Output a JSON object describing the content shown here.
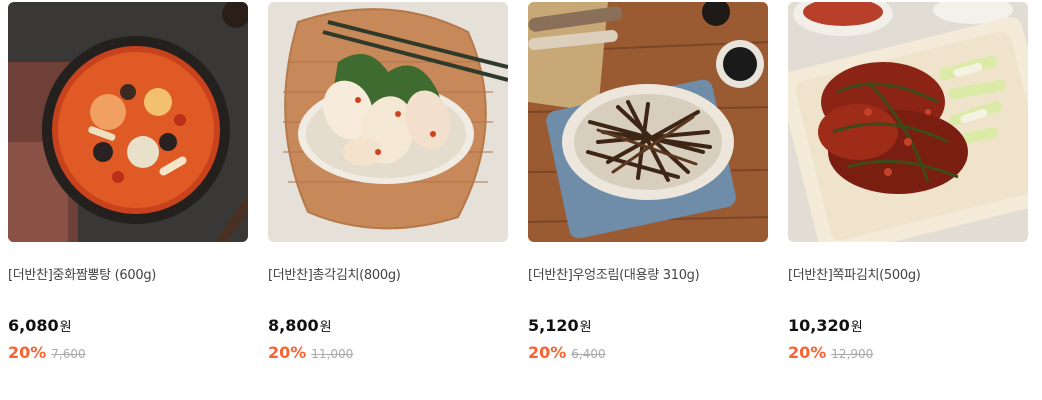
{
  "products": [
    {
      "name": "[더반찬]중화짬뽕탕 (600g)",
      "price": "6,080",
      "currency": "원",
      "discount": "20%",
      "original_price": "7,600",
      "image_icon": "jjamppong-soup-photo"
    },
    {
      "name": "[더반찬]총각김치(800g)",
      "price": "8,800",
      "currency": "원",
      "discount": "20%",
      "original_price": "11,000",
      "image_icon": "radish-kimchi-photo"
    },
    {
      "name": "[더반찬]우엉조림(대용량 310g)",
      "price": "5,120",
      "currency": "원",
      "discount": "20%",
      "original_price": "6,400",
      "image_icon": "burdock-root-photo"
    },
    {
      "name": "[더반찬]쪽파김치(500g)",
      "price": "10,320",
      "currency": "원",
      "discount": "20%",
      "original_price": "12,900",
      "image_icon": "green-onion-kimchi-photo"
    }
  ],
  "colors": {
    "discount": "#fa622f",
    "original_price": "#aaaaaa",
    "price": "#111111"
  }
}
